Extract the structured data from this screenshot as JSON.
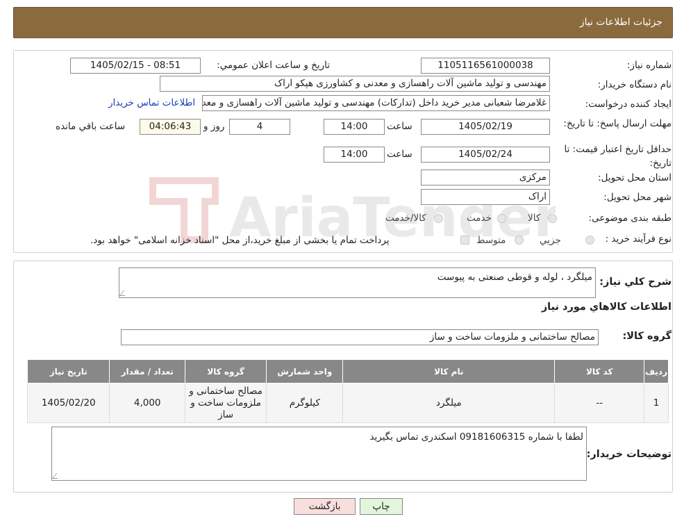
{
  "header": {
    "title": "جزئیات اطلاعات نیاز"
  },
  "watermark": {
    "text": "AriaTender.neT"
  },
  "details": {
    "need_number_label": "شماره نیاز:",
    "need_number": "1105116561000038",
    "announce_label": "تاریخ و ساعت اعلان عمومي:",
    "announce_value": "1405/02/15 - 08:51",
    "buyer_org_label": "نام دستگاه خریدار:",
    "buyer_org": "مهندسی و تولید ماشین آلات راهسازی و معدنی و کشاورزی هپکو اراک",
    "creator_label": "ایجاد کننده درخواست:",
    "creator": "غلامرضا شعبانی مدیر خرید داخل (تدارکات) مهندسی و تولید ماشین آلات راهسازی و معدنی و کشاورزی هپکو اراک",
    "contact_link": "اطلاعات تماس خریدار",
    "reply_deadline_label": "مهلت ارسال پاسخ: تا تاریخ:",
    "reply_date": "1405/02/19",
    "time_label": "ساعت",
    "reply_time": "14:00",
    "days_value": "4",
    "days_label": "روز و",
    "remaining_time": "04:06:43",
    "remaining_label": "ساعت باقي مانده",
    "price_validity_label": "حداقل تاریخ اعتبار قیمت: تا تاریخ:",
    "price_date": "1405/02/24",
    "price_time": "14:00",
    "province_label": "استان محل تحویل:",
    "province": "مرکزی",
    "city_label": "شهر محل تحویل:",
    "city": "اراک",
    "category_label": "طبقه بندی موضوعی:",
    "category_options": [
      "کالا",
      "خدمت",
      "کالا/خدمت"
    ],
    "process_label": "نوع فرآیند خرید :",
    "process_options": [
      "جزیي",
      "متوسط"
    ],
    "process_note": "پرداخت تمام یا بخشی از مبلغ خرید،از محل \"اسناد خزانه اسلامی\" خواهد بود."
  },
  "summary": {
    "label": "شرح کلي نیاز:",
    "value": "میلگرد ، لوله و قوطی صنعتی به پیوست",
    "goods_info_title": "اطلاعات کالاهاي مورد نیاز",
    "group_label": "گروه کالا:",
    "group_value": "مصالح ساختمانی و ملزومات ساخت و ساز"
  },
  "table": {
    "headers": [
      "ردیف",
      "کد کالا",
      "نام کالا",
      "واحد شمارش",
      "گروه کالا",
      "تعداد / مقدار",
      "تاریخ نیاز"
    ],
    "rows": [
      {
        "row": "1",
        "code": "--",
        "name": "میلگرد",
        "unit": "کیلوگرم",
        "group": "مصالح ساختمانی و ملزومات ساخت و ساز",
        "qty": "4,000",
        "date": "1405/02/20"
      }
    ]
  },
  "buyer_notes": {
    "label": "توضیحات خریدار:",
    "value": "لطفا با شماره 09181606315 اسکندری تماس بگیرید"
  },
  "buttons": {
    "print": "چاپ",
    "back": "بازگشت"
  },
  "colors": {
    "header_bg": "#8b6a3e",
    "table_header_bg": "#888888",
    "back_button_bg": "#f9dede",
    "print_button_bg": "#e3f6dc"
  }
}
